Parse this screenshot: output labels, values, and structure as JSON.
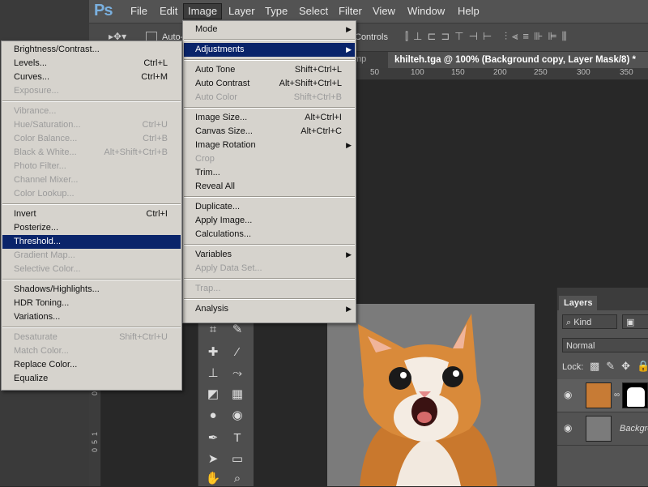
{
  "app": {
    "logo": "Ps",
    "menubar": [
      "File",
      "Edit",
      "Image",
      "Layer",
      "Type",
      "Select",
      "Filter",
      "View",
      "Window",
      "Help"
    ],
    "active_menu": "Image"
  },
  "options_bar": {
    "auto_label": "Auto-",
    "controls_label": "Controls"
  },
  "document": {
    "tab_prev": "mp",
    "tab_title": "khilteh.tga @ 100% (Background copy, Layer Mask/8) *",
    "hruler": [
      "50",
      "100",
      "150",
      "200",
      "250",
      "300",
      "350"
    ],
    "vruler": [
      "0",
      "1",
      "5",
      "0"
    ]
  },
  "image_menu": {
    "items": [
      {
        "label": "Mode",
        "shortcut": "",
        "submenu": true,
        "disabled": false
      },
      {
        "sep": true
      },
      {
        "label": "Adjustments",
        "shortcut": "",
        "submenu": true,
        "disabled": false,
        "highlight": true
      },
      {
        "sep": true
      },
      {
        "label": "Auto Tone",
        "shortcut": "Shift+Ctrl+L",
        "disabled": false
      },
      {
        "label": "Auto Contrast",
        "shortcut": "Alt+Shift+Ctrl+L",
        "disabled": false
      },
      {
        "label": "Auto Color",
        "shortcut": "Shift+Ctrl+B",
        "disabled": true
      },
      {
        "sep": true
      },
      {
        "label": "Image Size...",
        "shortcut": "Alt+Ctrl+I",
        "disabled": false
      },
      {
        "label": "Canvas Size...",
        "shortcut": "Alt+Ctrl+C",
        "disabled": false
      },
      {
        "label": "Image Rotation",
        "shortcut": "",
        "submenu": true,
        "disabled": false
      },
      {
        "label": "Crop",
        "shortcut": "",
        "disabled": true
      },
      {
        "label": "Trim...",
        "shortcut": "",
        "disabled": false
      },
      {
        "label": "Reveal All",
        "shortcut": "",
        "disabled": false
      },
      {
        "sep": true
      },
      {
        "label": "Duplicate...",
        "shortcut": "",
        "disabled": false
      },
      {
        "label": "Apply Image...",
        "shortcut": "",
        "disabled": false
      },
      {
        "label": "Calculations...",
        "shortcut": "",
        "disabled": false
      },
      {
        "sep": true
      },
      {
        "label": "Variables",
        "shortcut": "",
        "submenu": true,
        "disabled": false
      },
      {
        "label": "Apply Data Set...",
        "shortcut": "",
        "disabled": true
      },
      {
        "sep": true
      },
      {
        "label": "Trap...",
        "shortcut": "",
        "disabled": true
      },
      {
        "sep": true
      },
      {
        "label": "Analysis",
        "shortcut": "",
        "submenu": true,
        "disabled": false
      }
    ]
  },
  "adjustments_menu": {
    "items": [
      {
        "label": "Brightness/Contrast...",
        "shortcut": "",
        "disabled": false
      },
      {
        "label": "Levels...",
        "shortcut": "Ctrl+L",
        "disabled": false
      },
      {
        "label": "Curves...",
        "shortcut": "Ctrl+M",
        "disabled": false
      },
      {
        "label": "Exposure...",
        "shortcut": "",
        "disabled": true
      },
      {
        "sep": true
      },
      {
        "label": "Vibrance...",
        "shortcut": "",
        "disabled": true
      },
      {
        "label": "Hue/Saturation...",
        "shortcut": "Ctrl+U",
        "disabled": true
      },
      {
        "label": "Color Balance...",
        "shortcut": "Ctrl+B",
        "disabled": true
      },
      {
        "label": "Black & White...",
        "shortcut": "Alt+Shift+Ctrl+B",
        "disabled": true
      },
      {
        "label": "Photo Filter...",
        "shortcut": "",
        "disabled": true
      },
      {
        "label": "Channel Mixer...",
        "shortcut": "",
        "disabled": true
      },
      {
        "label": "Color Lookup...",
        "shortcut": "",
        "disabled": true
      },
      {
        "sep": true
      },
      {
        "label": "Invert",
        "shortcut": "Ctrl+I",
        "disabled": false
      },
      {
        "label": "Posterize...",
        "shortcut": "",
        "disabled": false
      },
      {
        "label": "Threshold...",
        "shortcut": "",
        "disabled": false,
        "highlight": true
      },
      {
        "label": "Gradient Map...",
        "shortcut": "",
        "disabled": true
      },
      {
        "label": "Selective Color...",
        "shortcut": "",
        "disabled": true
      },
      {
        "sep": true
      },
      {
        "label": "Shadows/Highlights...",
        "shortcut": "",
        "disabled": false
      },
      {
        "label": "HDR Toning...",
        "shortcut": "",
        "disabled": false
      },
      {
        "label": "Variations...",
        "shortcut": "",
        "disabled": false
      },
      {
        "sep": true
      },
      {
        "label": "Desaturate",
        "shortcut": "Shift+Ctrl+U",
        "disabled": true
      },
      {
        "label": "Match Color...",
        "shortcut": "",
        "disabled": true
      },
      {
        "label": "Replace Color...",
        "shortcut": "",
        "disabled": false
      },
      {
        "label": "Equalize",
        "shortcut": "",
        "disabled": false
      }
    ]
  },
  "layers_panel": {
    "tab": "Layers",
    "filter_kind": "Kind",
    "blend_mode": "Normal",
    "lock_label": "Lock:",
    "layers": [
      {
        "name": "",
        "has_mask": true
      },
      {
        "name": "Backgro",
        "has_mask": false
      }
    ]
  },
  "colors": {
    "menu_bg": "#d6d3cd",
    "highlight": "#0a246a",
    "disabled": "#9b9b9b"
  }
}
